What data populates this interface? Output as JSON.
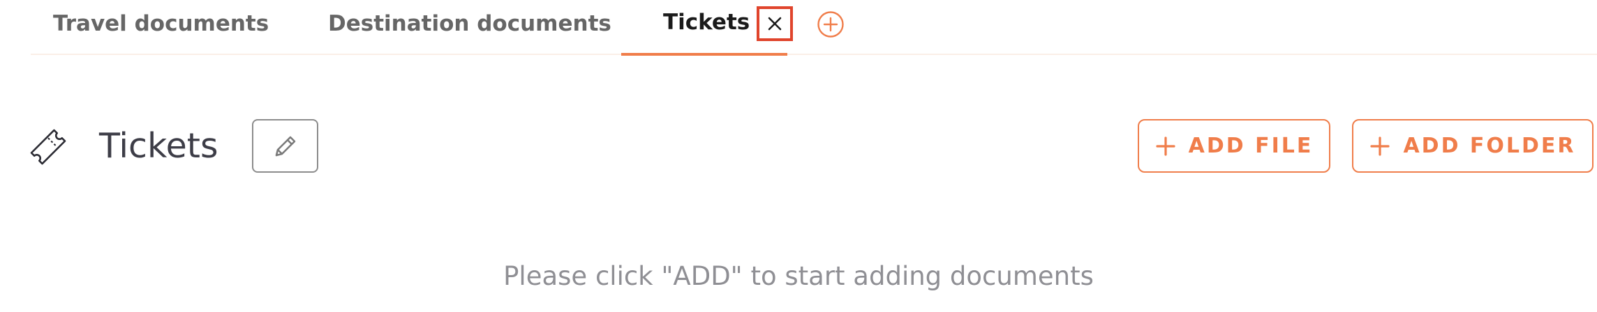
{
  "tabs": [
    {
      "label": "Travel documents",
      "active": false
    },
    {
      "label": "Destination documents",
      "active": false
    },
    {
      "label": "Tickets",
      "active": true
    }
  ],
  "tab_actions": {
    "close_icon": "close-icon",
    "add_icon": "plus-circle-icon"
  },
  "header": {
    "icon": "ticket-icon",
    "title": "Tickets",
    "edit_icon": "pencil-icon"
  },
  "actions": {
    "add_file_label": "ADD FILE",
    "add_folder_label": "ADD FOLDER"
  },
  "empty_state": {
    "message": "Please click \"ADD\" to start adding documents"
  },
  "colors": {
    "accent": "#f07d4a",
    "close_highlight": "#e0442c",
    "muted_text": "#8f8f94",
    "tab_text": "#666666",
    "active_tab_text": "#1a1a1a"
  }
}
